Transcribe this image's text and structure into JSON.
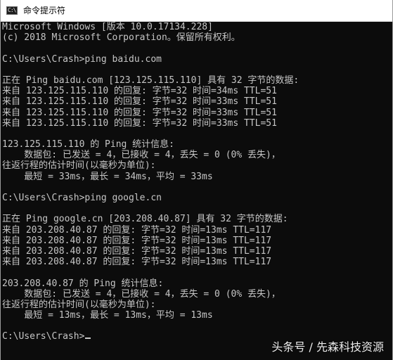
{
  "window": {
    "title": "命令提示符",
    "icon_name": "console-app-icon",
    "icon_glyph": "C:\\"
  },
  "console": {
    "lines": [
      "Microsoft Windows [版本 10.0.17134.228]",
      "(c) 2018 Microsoft Corporation。保留所有权利。",
      "",
      "C:\\Users\\Crash>ping baidu.com",
      "",
      "正在 Ping baidu.com [123.125.115.110] 具有 32 字节的数据:",
      "来自 123.125.115.110 的回复: 字节=32 时间=34ms TTL=51",
      "来自 123.125.115.110 的回复: 字节=32 时间=33ms TTL=51",
      "来自 123.125.115.110 的回复: 字节=32 时间=33ms TTL=51",
      "来自 123.125.115.110 的回复: 字节=32 时间=33ms TTL=51",
      "",
      "123.125.115.110 的 Ping 统计信息:",
      "    数据包: 已发送 = 4，已接收 = 4，丢失 = 0 (0% 丢失)，",
      "往返行程的估计时间(以毫秒为单位):",
      "    最短 = 33ms，最长 = 34ms，平均 = 33ms",
      "",
      "C:\\Users\\Crash>ping google.cn",
      "",
      "正在 Ping google.cn [203.208.40.87] 具有 32 字节的数据:",
      "来自 203.208.40.87 的回复: 字节=32 时间=13ms TTL=117",
      "来自 203.208.40.87 的回复: 字节=32 时间=13ms TTL=117",
      "来自 203.208.40.87 的回复: 字节=32 时间=13ms TTL=117",
      "来自 203.208.40.87 的回复: 字节=32 时间=13ms TTL=117",
      "",
      "203.208.40.87 的 Ping 统计信息:",
      "    数据包: 已发送 = 4，已接收 = 4，丢失 = 0 (0% 丢失)，",
      "往返行程的估计时间(以毫秒为单位):",
      "    最短 = 13ms，最长 = 13ms，平均 = 13ms",
      "",
      "C:\\Users\\Crash>"
    ]
  },
  "watermark": "头条号 / 先森科技资源",
  "colors": {
    "console_background": "#0c0c0c",
    "console_text": "#c6c6c6",
    "titlebar_background": "#ffffff"
  }
}
